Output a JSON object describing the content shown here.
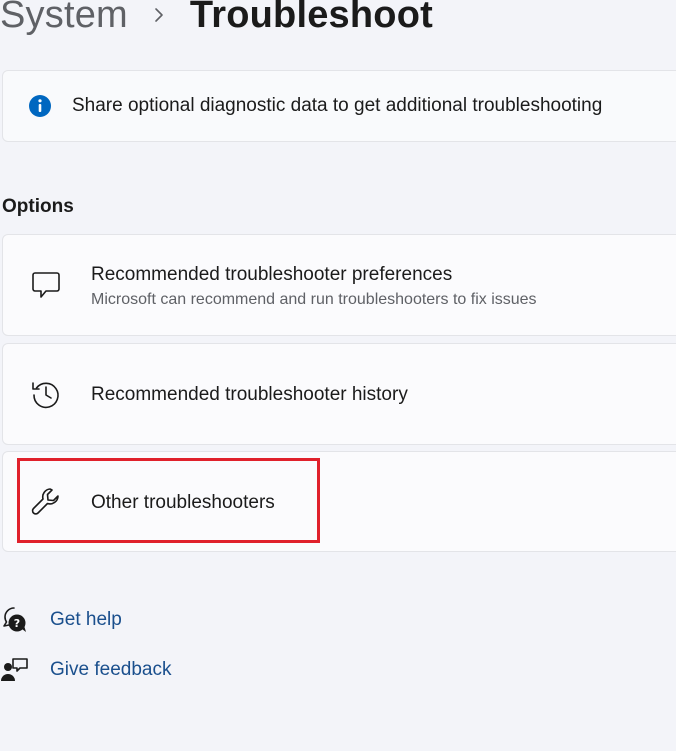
{
  "header": {
    "parent": "System",
    "current": "Troubleshoot"
  },
  "info_banner": {
    "text": "Share optional diagnostic data to get additional troubleshooting",
    "icon": "info-icon"
  },
  "options": {
    "section_label": "Options",
    "items": [
      {
        "title": "Recommended troubleshooter preferences",
        "subtitle": "Microsoft can recommend and run troubleshooters to fix issues",
        "icon": "chat-bubble-icon"
      },
      {
        "title": "Recommended troubleshooter history",
        "icon": "history-icon"
      },
      {
        "title": "Other troubleshooters",
        "icon": "wrench-icon"
      }
    ]
  },
  "links": [
    {
      "label": "Get help",
      "icon": "help-chat-icon"
    },
    {
      "label": "Give feedback",
      "icon": "feedback-icon"
    }
  ],
  "colors": {
    "background": "#f3f4f9",
    "card": "#fbfbfd",
    "accent": "#0067c0",
    "link": "#1a4f8d",
    "highlight": "#e0212b"
  }
}
